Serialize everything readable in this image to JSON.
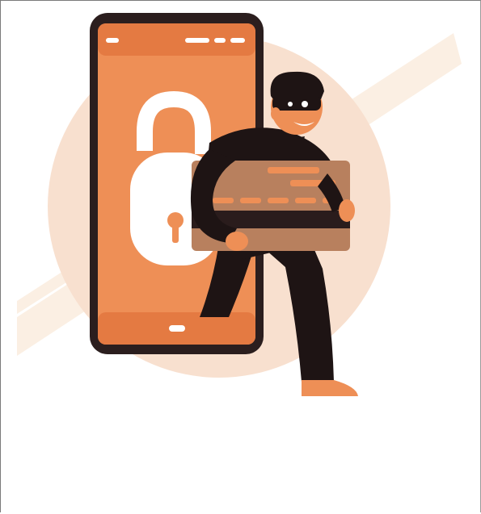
{
  "illustration": {
    "subject": "phone-theft",
    "colors": {
      "background_circle": "#F8E0CF",
      "streak": "#FBEFE3",
      "phone_body": "#2B1E1E",
      "phone_screen": "#EE8F56",
      "phone_screen_dark": "#E47A42",
      "padlock": "#FFFFFF",
      "card": "#B8805E",
      "card_stripe": "#2A1C1C",
      "card_detail": "#EE8F56",
      "thief_clothing": "#1E1414",
      "skin": "#EE8F56"
    }
  }
}
